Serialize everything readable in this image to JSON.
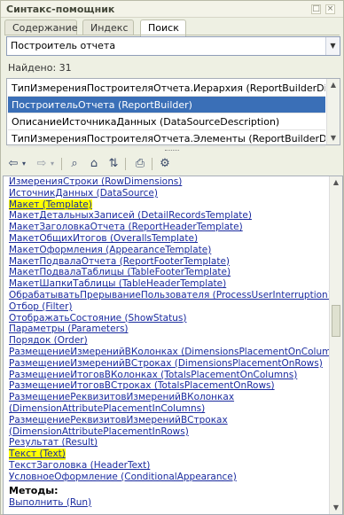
{
  "window": {
    "title": "Синтакс-помощник"
  },
  "tabs": [
    {
      "label": "Содержание"
    },
    {
      "label": "Индекс"
    },
    {
      "label": "Поиск"
    }
  ],
  "search": {
    "value": "Построитель отчета"
  },
  "found": "Найдено: 31",
  "results": [
    "ТипИзмеренияПостроителяОтчета.Иерархия (ReportBuilderDimensi...",
    "ПостроительОтчета (ReportBuilder)",
    "ОписаниеИсточникаДанных (DataSourceDescription)",
    "ТипИзмеренияПостроителяОтчета.Элементы (ReportBuilderDimens..."
  ],
  "toolbar": {
    "icons": [
      "back-icon",
      "forward-icon",
      "find-in-list-icon",
      "home-icon",
      "sync-icon",
      "print-icon",
      "settings-icon"
    ]
  },
  "content": {
    "properties": [
      "ИзмеренияСтроки (RowDimensions)",
      "ИсточникДанных (DataSource)",
      "Макет (Template)",
      "МакетДетальныхЗаписей (DetailRecordsTemplate)",
      "МакетЗаголовкаОтчета (ReportHeaderTemplate)",
      "МакетОбщихИтогов (OverallsTemplate)",
      "МакетОформления (AppearanceTemplate)",
      "МакетПодвалаОтчета (ReportFooterTemplate)",
      "МакетПодвалаТаблицы (TableFooterTemplate)",
      "МакетШапкиТаблицы (TableHeaderTemplate)",
      "ОбрабатыватьПрерываниеПользователя (ProcessUserInterruption)",
      "Отбор (Filter)",
      "ОтображатьСостояние (ShowStatus)",
      "Параметры (Parameters)",
      "Порядок (Order)",
      "РазмещениеИзмеренийВКолонках (DimensionsPlacementOnColumns)",
      "РазмещениеИзмеренийВСтроках (DimensionsPlacementOnRows)",
      "РазмещениеИтоговВКолонках (TotalsPlacementOnColumns)",
      "РазмещениеИтоговВСтроках (TotalsPlacementOnRows)",
      "РазмещениеРеквизитовИзмеренийВКолонках",
      "(DimensionAttributePlacementInColumns)",
      "РазмещениеРеквизитовИзмеренийВСтроках",
      "(DimensionAttributePlacementInRows)",
      "Результат (Result)",
      "Текст (Text)",
      "ТекстЗаголовка (HeaderText)",
      "УсловноеОформление (ConditionalAppearance)"
    ],
    "methods_heading": "Методы:",
    "methods": [
      "Выполнить (Run)"
    ]
  },
  "colors": {
    "highlight": "#ffff00",
    "selection": "#3a6fb7",
    "link": "#1a2b9f"
  }
}
